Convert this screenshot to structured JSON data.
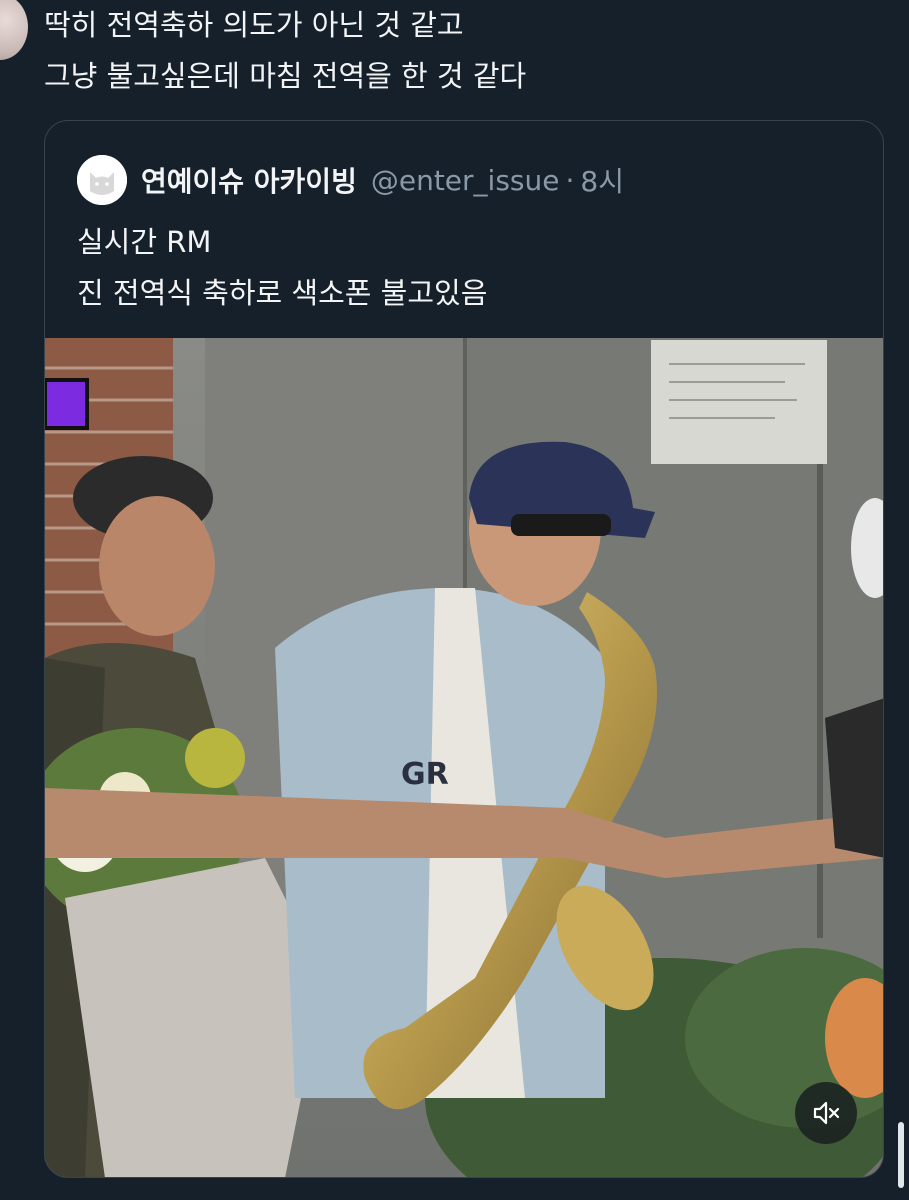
{
  "tweet": {
    "lines": [
      "딱히 전역축하 의도가 아닌 것 같고",
      "그냥 불고싶은데 마침 전역을 한 것 같다"
    ]
  },
  "quote": {
    "display_name": "연예이슈 아카이빙",
    "handle": "@enter_issue",
    "separator": "·",
    "time": "8시",
    "lines": [
      "실시간 RM",
      "진 전역식 축하로 색소폰 불고있음"
    ],
    "media": {
      "jersey_text": "GR",
      "mute_icon": "speaker-muted-icon"
    }
  },
  "icons": {
    "avatar_icon": "cat-face-icon",
    "mute_icon": "speaker-muted-icon"
  },
  "colors": {
    "background": "#15202b",
    "border": "#38444d",
    "secondary_text": "#8b98a5"
  }
}
